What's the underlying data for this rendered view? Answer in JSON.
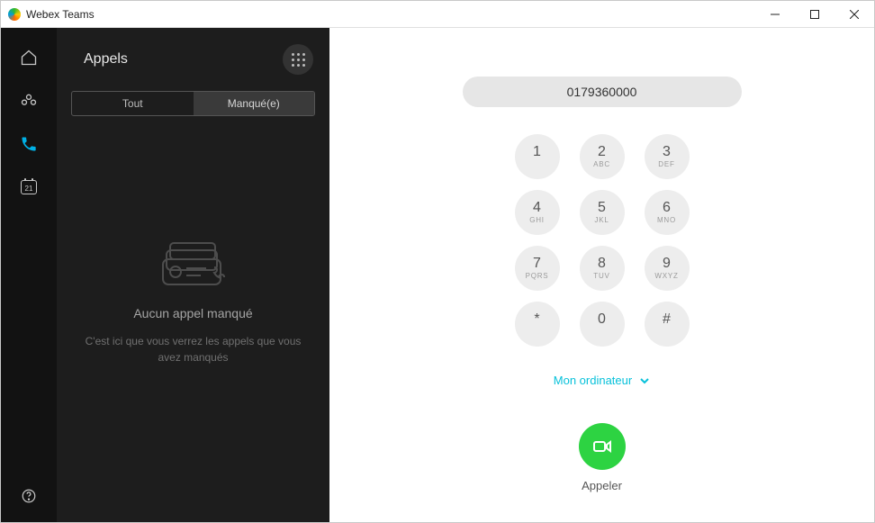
{
  "titlebar": {
    "app_name": "Webex Teams"
  },
  "nav": {
    "calendar_day": "21"
  },
  "sidebar": {
    "title": "Appels",
    "tabs": {
      "all": "Tout",
      "missed": "Manqué(e)"
    },
    "empty": {
      "heading": "Aucun appel manqué",
      "body": "C'est ici que vous verrez les appels que vous avez manqués"
    }
  },
  "dialer": {
    "number": "0179360000",
    "keys": [
      {
        "digit": "1",
        "sub": ""
      },
      {
        "digit": "2",
        "sub": "ABC"
      },
      {
        "digit": "3",
        "sub": "DEF"
      },
      {
        "digit": "4",
        "sub": "GHI"
      },
      {
        "digit": "5",
        "sub": "JKL"
      },
      {
        "digit": "6",
        "sub": "MNO"
      },
      {
        "digit": "7",
        "sub": "PQRS"
      },
      {
        "digit": "8",
        "sub": "TUV"
      },
      {
        "digit": "9",
        "sub": "WXYZ"
      },
      {
        "digit": "*",
        "sub": ""
      },
      {
        "digit": "0",
        "sub": ""
      },
      {
        "digit": "#",
        "sub": ""
      }
    ],
    "device_label": "Mon ordinateur",
    "call_label": "Appeler"
  }
}
